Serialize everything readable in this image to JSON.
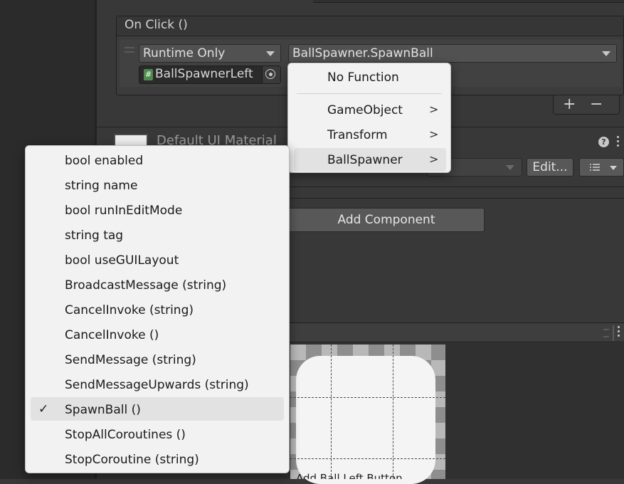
{
  "on_click": {
    "title": "On Click ()",
    "runtime_dropdown": "Runtime Only",
    "function_dropdown": "BallSpawner.SpawnBall",
    "target_object": "BallSpawnerLeft",
    "script_glyph": "#",
    "add_label": "+",
    "remove_label": "−"
  },
  "material": {
    "title": "Default UI Material",
    "help_glyph": "?",
    "edit_button": "Edit..."
  },
  "add_component": "Add Component",
  "preview": {
    "caption": "Add Ball Left Button"
  },
  "function_menu": {
    "no_function": "No Function",
    "items": [
      {
        "label": "GameObject",
        "submenu": true
      },
      {
        "label": "Transform",
        "submenu": true
      },
      {
        "label": "BallSpawner",
        "submenu": true,
        "highlighted": true
      }
    ]
  },
  "ballspawner_menu": {
    "items": [
      {
        "label": "bool enabled"
      },
      {
        "label": "string name"
      },
      {
        "label": "bool runInEditMode"
      },
      {
        "label": "string tag"
      },
      {
        "label": "bool useGUILayout"
      },
      {
        "label": "BroadcastMessage (string)"
      },
      {
        "label": "CancelInvoke (string)"
      },
      {
        "label": "CancelInvoke ()"
      },
      {
        "label": "SendMessage (string)"
      },
      {
        "label": "SendMessageUpwards (string)"
      },
      {
        "label": "SpawnBall ()",
        "checked": true
      },
      {
        "label": "StopAllCoroutines ()"
      },
      {
        "label": "StopCoroutine (string)"
      }
    ],
    "check_glyph": "✓"
  },
  "icons": {
    "submenu_arrow": ">",
    "picker": "target-icon",
    "list": "list-icon"
  }
}
